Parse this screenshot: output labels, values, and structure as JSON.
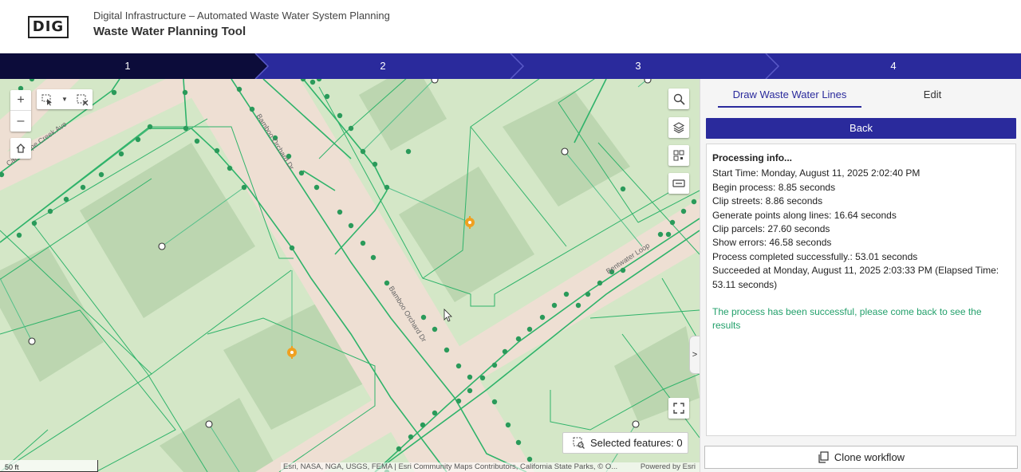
{
  "app": {
    "logo": "DIG",
    "subtitle": "Digital Infrastructure – Automated Waste Water System Planning",
    "title": "Waste Water Planning Tool"
  },
  "stepper": {
    "steps": [
      "1",
      "2",
      "3",
      "4"
    ],
    "active_step": "1",
    "colors": {
      "active": "#0c0c3a",
      "inactive": "#2a2a9c"
    }
  },
  "map": {
    "streets": [
      "Cantaloupe Creek Ave",
      "Bamboo Orchard Dr",
      "Bamboo Orchard Dr",
      "Bentwater Loop"
    ],
    "scale_label": "50 ft",
    "attribution": "Esri, NASA, NGA, USGS, FEMA | Esri Community Maps Contributors, California State Parks, © O...",
    "powered_by": "Powered by Esri",
    "selected_features_label": "Selected features: 0",
    "tools": [
      "zoom-in-icon",
      "zoom-out-icon",
      "home-icon",
      "select-icon",
      "clear-selection-icon",
      "search-icon",
      "layers-icon",
      "qr-icon",
      "measure-icon",
      "fullscreen-icon"
    ],
    "colors": {
      "parcel": "#d4e7c7",
      "road": "#eedfd3",
      "line": "#2fb36a",
      "point": "#2a9a5a",
      "marker": "#f0a020"
    }
  },
  "panel": {
    "tabs": [
      "Draw Waste Water Lines",
      "Edit"
    ],
    "active_tab": "Draw Waste Water Lines",
    "back_label": "Back",
    "info_heading": "Processing info...",
    "info_lines": [
      "Start Time: Monday, August 11, 2025 2:02:40 PM",
      "Begin process: 8.85 seconds",
      "Clip streets: 8.86 seconds",
      "Generate points along lines: 16.64 seconds",
      "Clip parcels: 27.60 seconds",
      "Show errors: 46.58 seconds",
      "Process completed successfully.: 53.01 seconds",
      "Succeeded at Monday, August 11, 2025 2:03:33 PM (Elapsed Time: 53.11 seconds)"
    ],
    "success_message": "The process has been successful, please come back to see the results",
    "clone_label": "Clone workflow"
  }
}
